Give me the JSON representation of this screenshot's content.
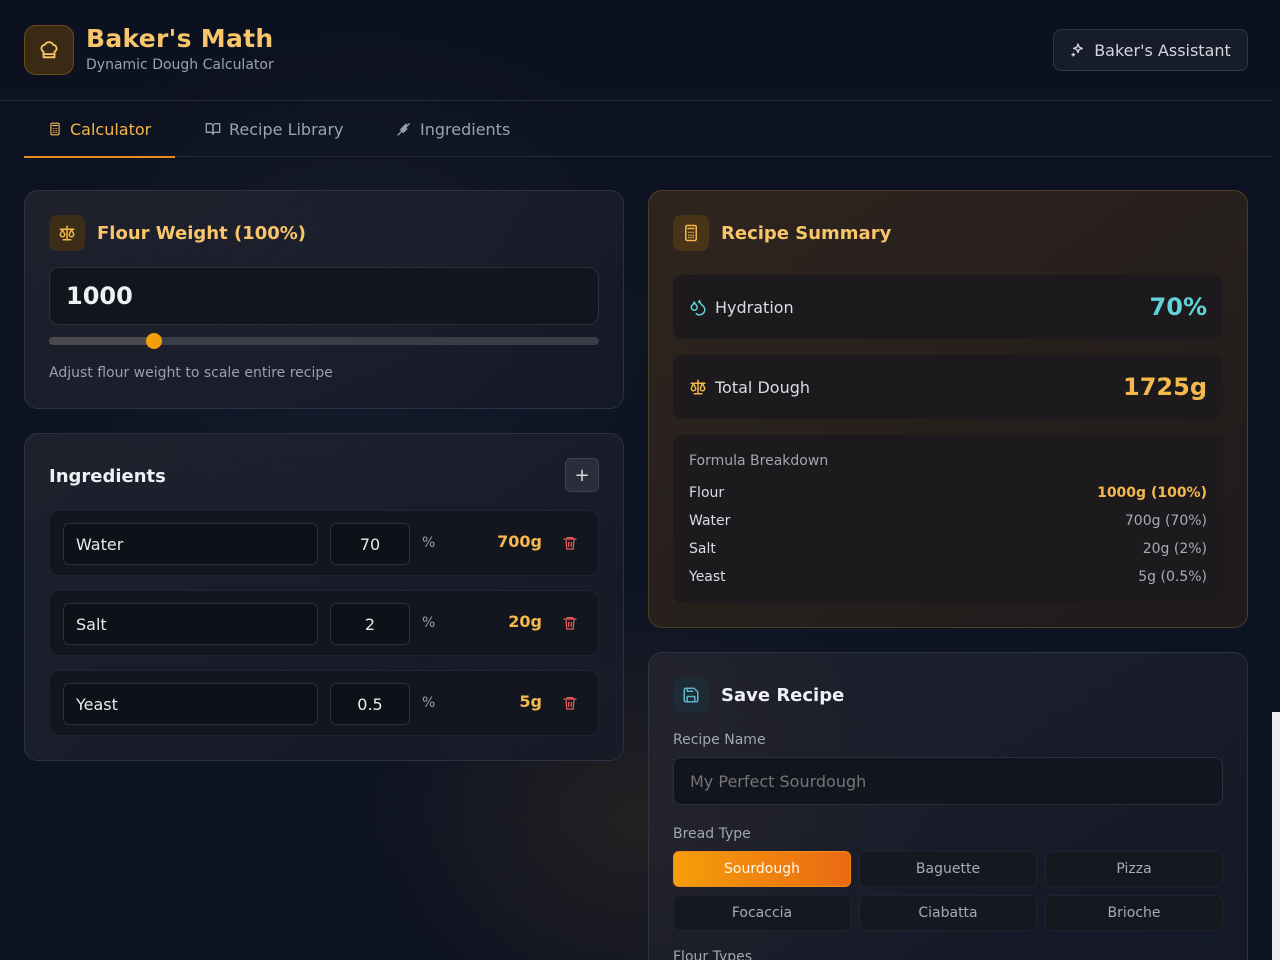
{
  "app": {
    "title": "Baker's Math",
    "subtitle": "Dynamic Dough Calculator",
    "assistant_label": "Baker's Assistant"
  },
  "tabs": [
    {
      "label": "Calculator",
      "active": true
    },
    {
      "label": "Recipe Library",
      "active": false
    },
    {
      "label": "Ingredients",
      "active": false
    }
  ],
  "flour_card": {
    "title": "Flour Weight (100%)",
    "value": "1000",
    "slider_fraction": 0.19,
    "hint": "Adjust flour weight to scale entire recipe"
  },
  "ingredients_card": {
    "title": "Ingredients",
    "add_label": "+",
    "percent_sign": "%",
    "items": [
      {
        "name": "Water",
        "percent": "70",
        "grams": "700g"
      },
      {
        "name": "Salt",
        "percent": "2",
        "grams": "20g"
      },
      {
        "name": "Yeast",
        "percent": "0.5",
        "grams": "5g"
      }
    ]
  },
  "summary": {
    "title": "Recipe Summary",
    "hydration_label": "Hydration",
    "hydration_value": "70%",
    "total_label": "Total Dough",
    "total_value": "1725g",
    "breakdown_title": "Formula Breakdown",
    "breakdown": [
      {
        "label": "Flour",
        "value": "1000g (100%)"
      },
      {
        "label": "Water",
        "value": "700g (70%)"
      },
      {
        "label": "Salt",
        "value": "20g (2%)"
      },
      {
        "label": "Yeast",
        "value": "5g (0.5%)"
      }
    ]
  },
  "save": {
    "title": "Save Recipe",
    "name_label": "Recipe Name",
    "name_placeholder": "My Perfect Sourdough",
    "bread_type_label": "Bread Type",
    "bread_types": [
      "Sourdough",
      "Baguette",
      "Pizza",
      "Focaccia",
      "Ciabatta",
      "Brioche"
    ],
    "selected_bread_type": "Sourdough",
    "flour_types_label": "Flour Types"
  },
  "colors": {
    "accent": "#f5b84a",
    "hydration": "#5fd3d8",
    "brand_orange": "#f59e0b"
  }
}
